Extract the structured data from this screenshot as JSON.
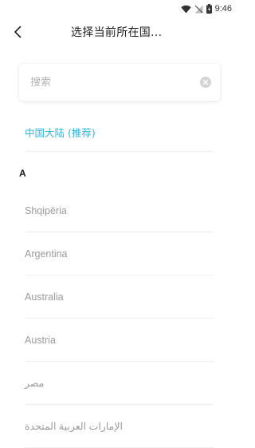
{
  "status_bar": {
    "time": "9:46"
  },
  "header": {
    "title": "选择当前所在国..."
  },
  "search": {
    "placeholder": "搜索",
    "value": ""
  },
  "recommended": {
    "label": "中国大陆 (推荐)"
  },
  "section": {
    "letter": "A"
  },
  "countries": [
    {
      "label": "Shqipëria"
    },
    {
      "label": "Argentina"
    },
    {
      "label": "Australia"
    },
    {
      "label": "Austria"
    },
    {
      "label": "مصر"
    },
    {
      "label": "الإمارات العربية المتحدة"
    }
  ],
  "colors": {
    "accent": "#2fb6e0",
    "text_muted": "#9b9b9b",
    "divider": "#f0f0f0"
  }
}
